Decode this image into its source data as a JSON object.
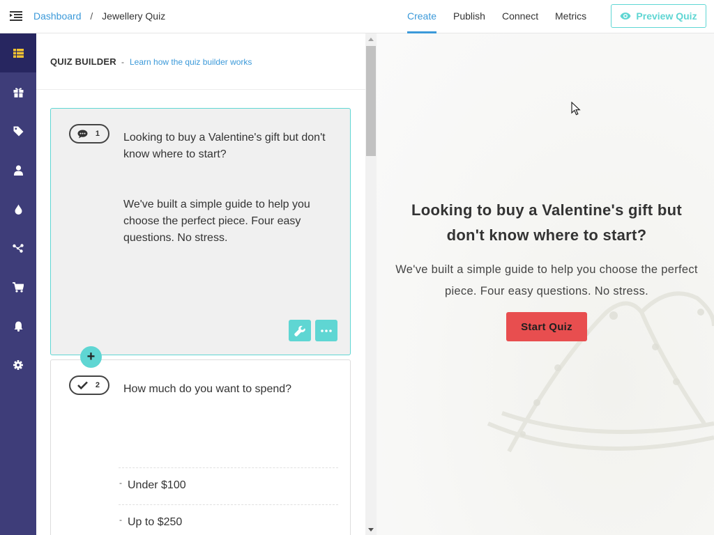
{
  "breadcrumb": {
    "root": "Dashboard",
    "separator": "/",
    "current": "Jewellery Quiz"
  },
  "top_tabs": [
    {
      "label": "Create",
      "active": true
    },
    {
      "label": "Publish",
      "active": false
    },
    {
      "label": "Connect",
      "active": false
    },
    {
      "label": "Metrics",
      "active": false
    }
  ],
  "preview_button": {
    "label": "Preview Quiz",
    "icon": "eye-icon"
  },
  "sidebar": {
    "items": [
      {
        "icon": "list-icon",
        "active": true
      },
      {
        "icon": "gift-icon",
        "active": false
      },
      {
        "icon": "tag-icon",
        "active": false
      },
      {
        "icon": "user-icon",
        "active": false
      },
      {
        "icon": "drop-icon",
        "active": false
      },
      {
        "icon": "flow-icon",
        "active": false
      },
      {
        "icon": "cart-icon",
        "active": false
      },
      {
        "icon": "bell-icon",
        "active": false
      },
      {
        "icon": "gear-icon",
        "active": false
      }
    ]
  },
  "builder": {
    "title": "QUIZ BUILDER",
    "dash": "-",
    "help_link": "Learn how the quiz builder works",
    "cards": [
      {
        "number": "1",
        "icon": "comment-icon",
        "question": "Looking to buy a Valentine's gift but don't know where to start?",
        "description": "We've built a simple guide to help you choose the perfect piece. Four easy questions. No stress."
      },
      {
        "number": "2",
        "icon": "check-icon",
        "question": "How much do you want to spend?",
        "answers": [
          "Under $100",
          "Up to $250"
        ]
      }
    ],
    "add_label": "+",
    "answer_dash": "-"
  },
  "preview": {
    "question": "Looking to buy a Valentine's gift but don't know where to start?",
    "description": "We've built a simple guide to help you choose the perfect piece. Four easy questions. No stress.",
    "start_button": "Start Quiz"
  },
  "colors": {
    "accent_blue": "#3b99d9",
    "teal": "#5fd6d3",
    "sidebar_bg": "#3e3d79",
    "sidebar_active": "#272660",
    "start_button": "#e84e4f"
  }
}
